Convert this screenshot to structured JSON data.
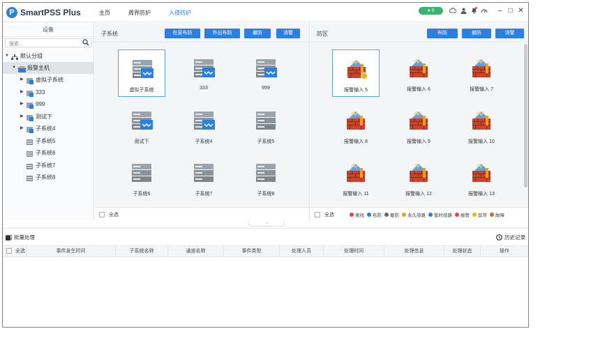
{
  "app": {
    "title": "SmartPSS Plus",
    "logo_letter": "P"
  },
  "nav": [
    {
      "label": "主页",
      "active": false
    },
    {
      "label": "周界防护",
      "active": false
    },
    {
      "label": "入侵防护",
      "active": true
    }
  ],
  "status_pill": "● 0",
  "window_controls": [
    "–",
    "□",
    "✕"
  ],
  "device_panel": {
    "header": "设备",
    "search_placeholder": "搜索...",
    "tree": [
      {
        "label": "默认分组",
        "level": 0,
        "expanded": true,
        "icon": "group-icon"
      },
      {
        "label": "报警主机",
        "level": 1,
        "expanded": true,
        "icon": "alarm-host-icon",
        "selected": true
      },
      {
        "label": "虚拟子系统",
        "level": 2,
        "icon": "subsystem-icon"
      },
      {
        "label": "333",
        "level": 2,
        "icon": "subsystem-icon"
      },
      {
        "label": "999",
        "level": 2,
        "icon": "subsystem-icon"
      },
      {
        "label": "测试下",
        "level": 2,
        "icon": "subsystem-icon"
      },
      {
        "label": "子系统4",
        "level": 2,
        "icon": "subsystem-icon"
      },
      {
        "label": "子系统5",
        "level": 2,
        "icon": "subsystem-grey-icon"
      },
      {
        "label": "子系统6",
        "level": 2,
        "icon": "subsystem-grey-icon"
      },
      {
        "label": "子系统7",
        "level": 2,
        "icon": "subsystem-grey-icon"
      },
      {
        "label": "子系统8",
        "level": 2,
        "icon": "subsystem-grey-icon"
      }
    ]
  },
  "subsystem_panel": {
    "title": "子系统",
    "buttons": [
      "在家布防",
      "外出布防",
      "撤防",
      "消警"
    ],
    "items": [
      {
        "label": "虚拟子系统",
        "state": "armed",
        "selected": true
      },
      {
        "label": "333",
        "state": "armed"
      },
      {
        "label": "999",
        "state": "armed"
      },
      {
        "label": "测试下",
        "state": "armed"
      },
      {
        "label": "子系统4",
        "state": "armed"
      },
      {
        "label": "子系统5",
        "state": "idle"
      },
      {
        "label": "子系统6",
        "state": "idle"
      },
      {
        "label": "子系统7",
        "state": "idle"
      },
      {
        "label": "子系统8",
        "state": "idle"
      }
    ],
    "select_all": "全选"
  },
  "zone_panel": {
    "title": "防区",
    "buttons": [
      "布防",
      "撤防",
      "消警"
    ],
    "items": [
      {
        "label": "报警输入 5",
        "selected": true,
        "badge": true
      },
      {
        "label": "报警输入 6"
      },
      {
        "label": "报警输入 7"
      },
      {
        "label": "报警输入 8"
      },
      {
        "label": "报警输入 9"
      },
      {
        "label": "报警输入 10"
      },
      {
        "label": "报警输入 11"
      },
      {
        "label": "报警输入 12"
      },
      {
        "label": "报警输入 13"
      }
    ],
    "select_all": "全选",
    "legend": [
      {
        "label": "离线",
        "color": "#e04848"
      },
      {
        "label": "布防",
        "color": "#2a7fe0"
      },
      {
        "label": "撤防",
        "color": "#5a6a7a"
      },
      {
        "label": "永久旁路",
        "color": "#f0a020"
      },
      {
        "label": "暂时旁路",
        "color": "#2a7fe0"
      },
      {
        "label": "报警",
        "color": "#e04848"
      },
      {
        "label": "异常",
        "color": "#f0b400"
      },
      {
        "label": "故障",
        "color": "#e06020"
      }
    ]
  },
  "events": {
    "batch_label": "批量处理",
    "history_label": "历史记录",
    "columns": [
      "全选",
      "事件发生时间",
      "子系统名称",
      "通道名称",
      "事件类型",
      "处理人员",
      "处理时间",
      "处理信息",
      "处理状态",
      "操作"
    ]
  },
  "colors": {
    "accent": "#2a7fe0",
    "border": "#4a8fd4",
    "panel_bg": "#f4f5f7"
  }
}
